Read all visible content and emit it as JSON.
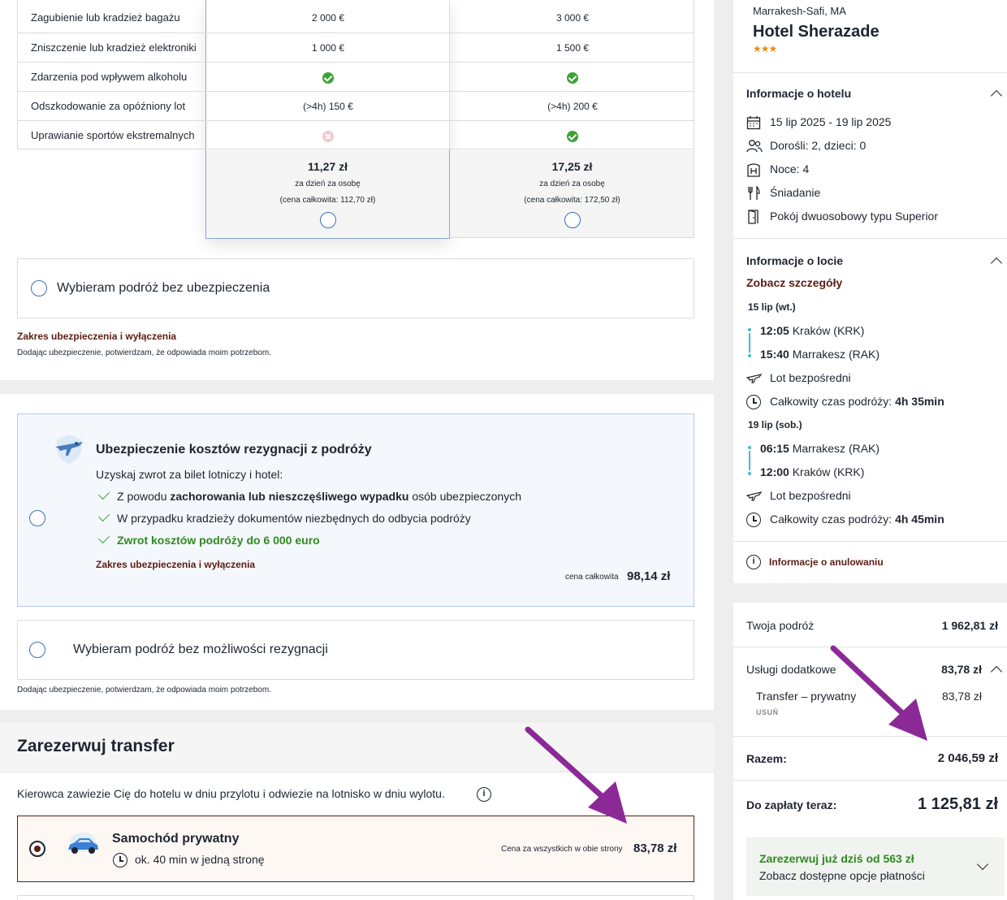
{
  "insurance_table": {
    "rows": [
      {
        "label": "Zagubienie lub kradzież bagażu",
        "a": "2 000 €",
        "b": "3 000 €"
      },
      {
        "label": "Zniszczenie lub kradzież elektroniki",
        "a": "1 000 €",
        "b": "1 500 €"
      },
      {
        "label": "Zdarzenia pod wpływem alkoholu",
        "a": "",
        "b": ""
      },
      {
        "label": "Odszkodowanie za opóźniony lot",
        "a": "(>4h) 150 €",
        "b": "(>4h) 200 €"
      },
      {
        "label": "Uprawianie sportów ekstremalnych",
        "a": "",
        "b": ""
      }
    ],
    "plan_a": {
      "price": "11,27 zł",
      "per": "za dzień za osobę",
      "total": "(cena całkowita: 112,70 zł)"
    },
    "plan_b": {
      "price": "17,25 zł",
      "per": "za dzień za osobę",
      "total": "(cena całkowita: 172,50 zł)"
    },
    "no_insurance": "Wybieram podróż bez ubezpieczenia",
    "scope_link": "Zakres ubezpieczenia i wyłączenia",
    "disclaimer": "Dodając ubezpieczenie, potwierdzam, że odpowiada moim potrzebom."
  },
  "cancellation": {
    "title": "Ubezpieczenie kosztów rezygnacji z podróży",
    "intro": "Uzyskaj zwrot za bilet lotniczy i hotel:",
    "b1_pre": "Z powodu ",
    "b1_bold": "zachorowania lub nieszczęśliwego wypadku",
    "b1_post": " osób ubezpieczonych",
    "b2": "W przypadku kradzieży dokumentów niezbędnych do odbycia podróży",
    "b3": "Zwrot kosztów podróży do 6 000 euro",
    "scope_link": "Zakres ubezpieczenia i wyłączenia",
    "price_label": "cena całkowita",
    "price": "98,14 zł",
    "no_option": "Wybieram podróż bez możliwości rezygnacji",
    "disclaimer": "Dodając ubezpieczenie, potwierdzam, że odpowiada moim potrzebom."
  },
  "transfer": {
    "title": "Zarezerwuj transfer",
    "desc": "Kierowca zawiezie Cię do hotelu w dniu przylotu i odwiezie na lotnisko w dniu wylotu.",
    "option_title": "Samochód prywatny",
    "option_time": "ok. 40 min w jedną stronę",
    "price_label": "Cena za wszystkich w obie strony",
    "price": "83,78 zł"
  },
  "hotel": {
    "address_top": "Marrakesh-Safi, MA",
    "name": "Hotel Sherazade",
    "stars": "★★★",
    "section_title": "Informacje o hotelu",
    "dates": "15 lip 2025 - 19 lip 2025",
    "guests": "Dorośli: 2, dzieci: 0",
    "nights": "Noce: 4",
    "board": "Śniadanie",
    "room": "Pokój dwuosobowy typu Superior"
  },
  "flight": {
    "section_title": "Informacje o locie",
    "details_link": "Zobacz szczegóły",
    "out_date": "15 lip (wt.)",
    "out_dep_time": "12:05",
    "out_dep_place": "Kraków (KRK)",
    "out_arr_time": "15:40",
    "out_arr_place": "Marrakesz (RAK)",
    "direct": "Lot bezpośredni",
    "total_label": "Całkowity czas podróży: ",
    "out_total": "4h 35min",
    "ret_date": "19 lip (sob.)",
    "ret_dep_time": "06:15",
    "ret_dep_place": "Marrakesz (RAK)",
    "ret_arr_time": "12:00",
    "ret_arr_place": "Kraków (KRK)",
    "ret_total": "4h 45min",
    "cancel_info": "Informacje o anulowaniu"
  },
  "summary": {
    "trip_label": "Twoja podróż",
    "trip_value": "1 962,81 zł",
    "extras_label": "Usługi dodatkowe",
    "extras_value": "83,78 zł",
    "transfer_label": "Transfer – prywatny",
    "transfer_value": "83,78 zł",
    "remove": "USUŃ",
    "total_label": "Razem:",
    "total_value": "2 046,59 zł",
    "pay_label": "Do zapłaty teraz:",
    "pay_value": "1 125,81 zł",
    "promo_title": "Zarezerwuj już dziś od 563 zł",
    "promo_sub": "Zobacz dostępne opcje płatności"
  },
  "colors": {
    "accent_brown": "#5a1d12",
    "green": "#2e8b1e",
    "annotation_arrow": "#8b2a96",
    "selected_border": "#5a1d12"
  }
}
